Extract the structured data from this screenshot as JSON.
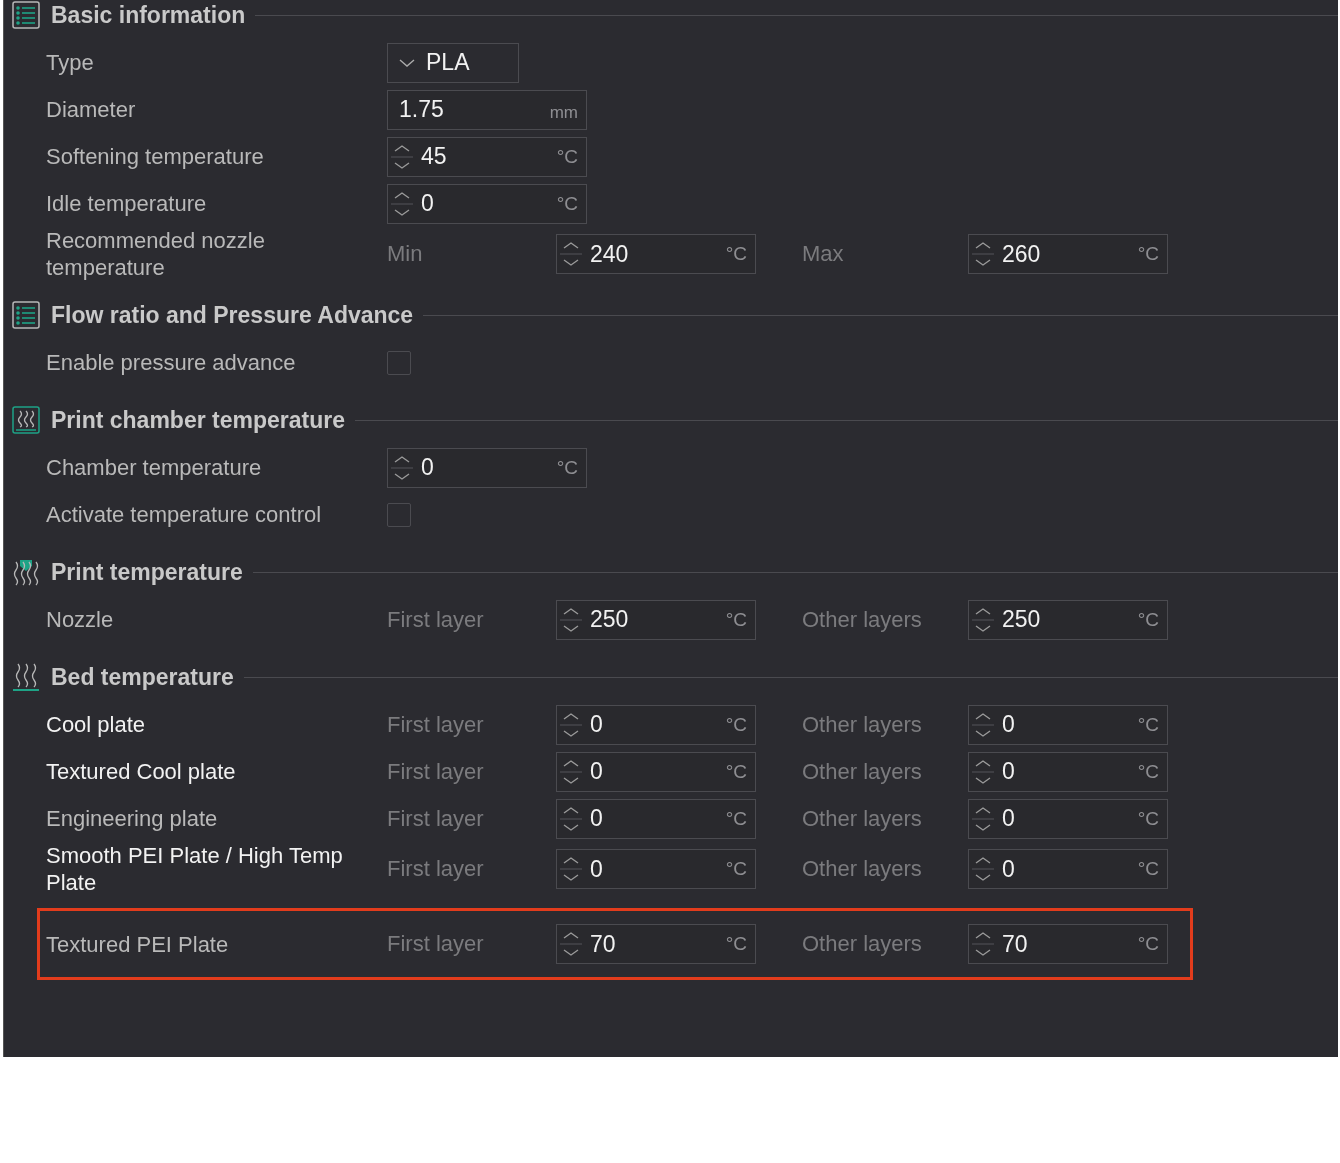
{
  "sections": [
    {
      "title": "Basic information",
      "kind": "list",
      "rows": [
        {
          "kind": "select",
          "label": "Type",
          "value": "PLA"
        },
        {
          "kind": "field",
          "label": "Diameter",
          "field": {
            "spinner": false,
            "value": "1.75",
            "unit": "mm"
          }
        },
        {
          "kind": "field",
          "label": "Softening temperature",
          "field": {
            "spinner": true,
            "value": "45",
            "unit": "°C"
          }
        },
        {
          "kind": "field",
          "label": "Idle temperature",
          "field": {
            "spinner": true,
            "value": "0",
            "unit": "°C"
          }
        },
        {
          "kind": "pair",
          "label": "Recommended nozzle temperature",
          "left_label": "Min",
          "left": {
            "spinner": true,
            "value": "240",
            "unit": "°C"
          },
          "right_label": "Max",
          "right": {
            "spinner": true,
            "value": "260",
            "unit": "°C"
          }
        }
      ]
    },
    {
      "title": "Flow ratio and Pressure Advance",
      "kind": "list",
      "rows": [
        {
          "kind": "checkbox",
          "label": "Enable pressure advance",
          "checked": false
        }
      ]
    },
    {
      "title": "Print chamber temperature",
      "kind": "chamber",
      "rows": [
        {
          "kind": "field",
          "label": "Chamber temperature",
          "field": {
            "spinner": true,
            "value": "0",
            "unit": "°C"
          }
        },
        {
          "kind": "checkbox",
          "label": "Activate temperature control",
          "checked": false
        }
      ]
    },
    {
      "title": "Print temperature",
      "kind": "nozzle",
      "rows": [
        {
          "kind": "pair",
          "label": "Nozzle",
          "left_label": "First layer",
          "left": {
            "spinner": true,
            "value": "250",
            "unit": "°C"
          },
          "right_label": "Other layers",
          "right": {
            "spinner": true,
            "value": "250",
            "unit": "°C"
          }
        }
      ]
    },
    {
      "title": "Bed temperature",
      "kind": "bed",
      "rows": [
        {
          "kind": "pair",
          "label": "Cool plate",
          "bright": true,
          "outlined": false,
          "left_label": "First layer",
          "left": {
            "spinner": true,
            "value": "0",
            "unit": "°C"
          },
          "right_label": "Other layers",
          "right": {
            "spinner": true,
            "value": "0",
            "unit": "°C"
          }
        },
        {
          "kind": "pair",
          "label": "Textured Cool plate",
          "bright": true,
          "outlined": false,
          "left_label": "First layer",
          "left": {
            "spinner": true,
            "value": "0",
            "unit": "°C"
          },
          "right_label": "Other layers",
          "right": {
            "spinner": true,
            "value": "0",
            "unit": "°C"
          }
        },
        {
          "kind": "pair",
          "label": "Engineering plate",
          "bright": false,
          "outlined": false,
          "left_label": "First layer",
          "left": {
            "spinner": true,
            "value": "0",
            "unit": "°C"
          },
          "right_label": "Other layers",
          "right": {
            "spinner": true,
            "value": "0",
            "unit": "°C"
          }
        },
        {
          "kind": "pair",
          "label": "Smooth PEI Plate / High Temp Plate",
          "bright": true,
          "outlined": false,
          "left_label": "First layer",
          "left": {
            "spinner": true,
            "value": "0",
            "unit": "°C"
          },
          "right_label": "Other layers",
          "right": {
            "spinner": true,
            "value": "0",
            "unit": "°C"
          }
        },
        {
          "kind": "pair",
          "label": "Textured PEI Plate",
          "bright": false,
          "outlined": true,
          "left_label": "First layer",
          "left": {
            "spinner": true,
            "value": "70",
            "unit": "°C"
          },
          "right_label": "Other layers",
          "right": {
            "spinner": true,
            "value": "70",
            "unit": "°C"
          }
        }
      ]
    }
  ]
}
